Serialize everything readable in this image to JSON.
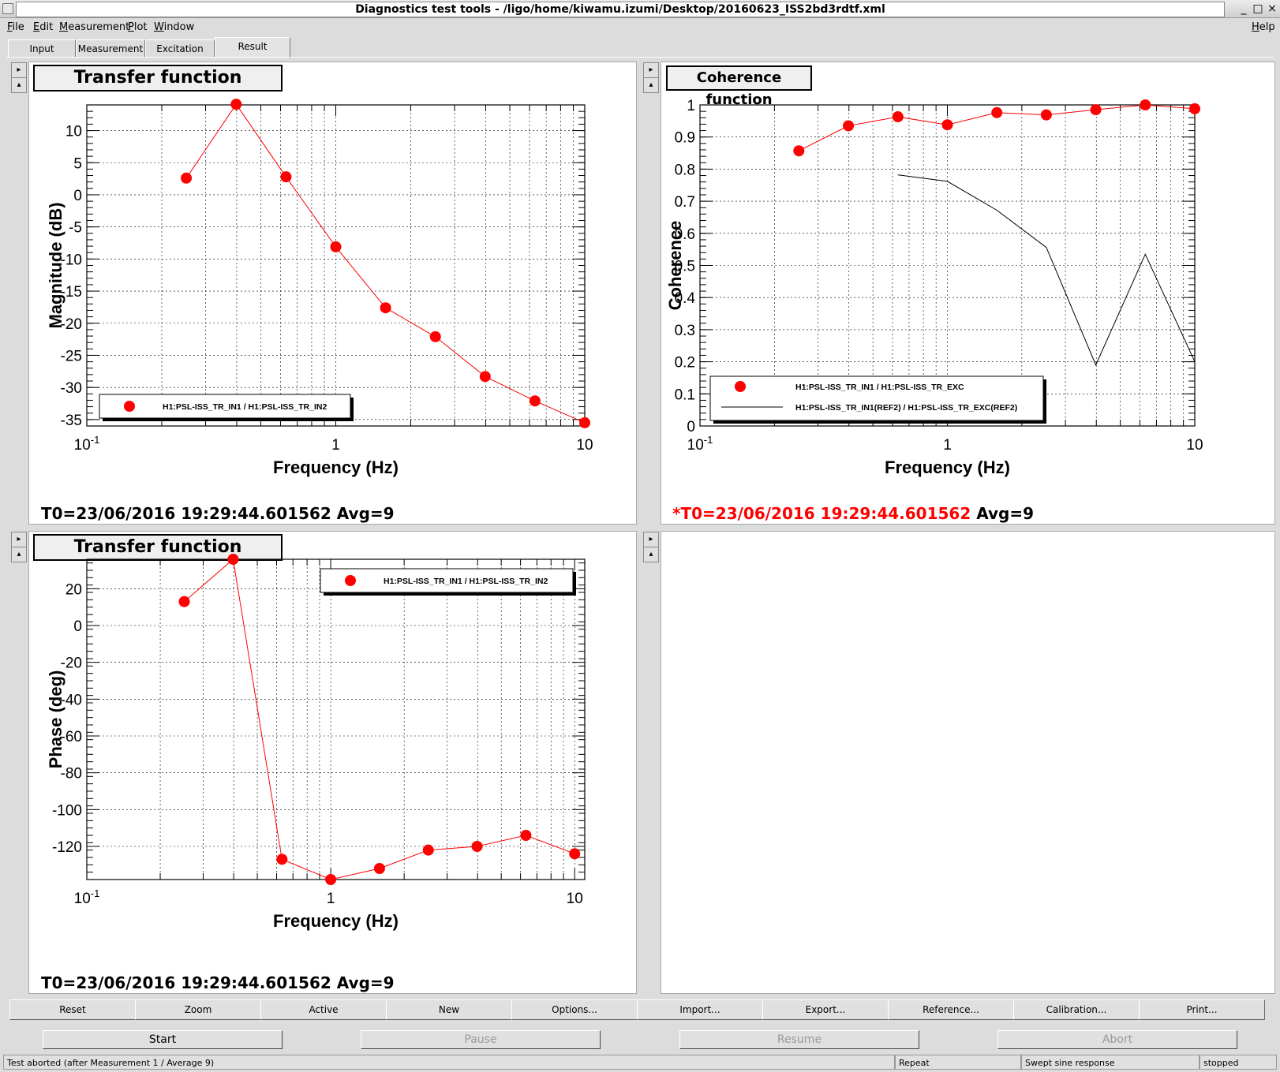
{
  "window": {
    "title": "Diagnostics test tools - /ligo/home/kiwamu.izumi/Desktop/20160623_ISS2bd3rdtf.xml",
    "minimize": "_",
    "maximize": "□",
    "close": "×"
  },
  "menu": {
    "file": "File",
    "edit": "Edit",
    "measurement": "Measurement",
    "plot": "Plot",
    "window": "Window",
    "help": "Help"
  },
  "tabs": [
    "Input",
    "Measurement",
    "Excitation",
    "Result"
  ],
  "active_tab": "Result",
  "side_buttons": {
    "expand": "▸",
    "collapse": "▴"
  },
  "panels": {
    "top_left": {
      "title": "Transfer function",
      "t0_line": "T0=23/06/2016 19:29:44.601562   Avg=9"
    },
    "top_right": {
      "title": "Coherence function",
      "t0_prefix": "*T0=23/06/2016 19:29:44.601562",
      "t0_suffix": " Avg=9"
    },
    "bottom_left": {
      "title": "Transfer function",
      "t0_line": "T0=23/06/2016 19:29:44.601562   Avg=9"
    }
  },
  "chart_data": [
    {
      "type": "line",
      "id": "magnitude",
      "xscale": "log",
      "xlim": [
        0.1,
        10
      ],
      "ylim": [
        -36,
        14
      ],
      "xlabel": "Frequency (Hz)",
      "ylabel": "Magnitude (dB)",
      "xticks": [
        0.1,
        1,
        10
      ],
      "xtick_labels": [
        "10",
        "1",
        "10"
      ],
      "yticks": [
        10,
        5,
        0,
        -5,
        -10,
        -15,
        -20,
        -25,
        -30,
        -35
      ],
      "ytick_labels": [
        "10",
        "5",
        "0",
        "-5",
        "-10",
        "-15",
        "-20",
        "-25",
        "-30",
        "-35"
      ],
      "grid": true,
      "legend": "bottom-left",
      "series": [
        {
          "name": "H1:PSL-ISS_TR_IN1 / H1:PSL-ISS_TR_IN2",
          "color": "#ff0000",
          "marker": "circle",
          "x": [
            0.251,
            0.398,
            0.631,
            1.0,
            1.585,
            2.512,
            3.981,
            6.31,
            10.0
          ],
          "y": [
            2.6,
            14.1,
            2.8,
            -8.1,
            -17.6,
            -22.1,
            -28.3,
            -32.1,
            -35.5
          ]
        }
      ]
    },
    {
      "type": "line",
      "id": "coherence",
      "xscale": "log",
      "xlim": [
        0.1,
        10
      ],
      "ylim": [
        0,
        1
      ],
      "xlabel": "Frequency (Hz)",
      "ylabel": "Coherence",
      "xticks": [
        0.1,
        1,
        10
      ],
      "xtick_labels": [
        "10",
        "1",
        "10"
      ],
      "yticks": [
        1,
        0.9,
        0.8,
        0.7,
        0.6,
        0.5,
        0.4,
        0.3,
        0.2,
        0.1,
        0
      ],
      "ytick_labels": [
        "1",
        "0.9",
        "0.8",
        "0.7",
        "0.6",
        "0.5",
        "0.4",
        "0.3",
        "0.2",
        "0.1",
        "0"
      ],
      "grid": true,
      "legend": "bottom-center",
      "series": [
        {
          "name": "H1:PSL-ISS_TR_IN1 / H1:PSL-ISS_TR_EXC",
          "color": "#ff0000",
          "marker": "circle",
          "x": [
            0.251,
            0.398,
            0.631,
            1.0,
            1.585,
            2.512,
            3.981,
            6.31,
            10.0
          ],
          "y": [
            0.857,
            0.935,
            0.963,
            0.938,
            0.976,
            0.969,
            0.985,
            1.0,
            0.988
          ]
        },
        {
          "name": "H1:PSL-ISS_TR_IN1(REF2) / H1:PSL-ISS_TR_EXC(REF2)",
          "color": "#000000",
          "marker": "none",
          "x": [
            0.631,
            1.0,
            1.585,
            2.512,
            3.981,
            6.31,
            10.0
          ],
          "y": [
            0.782,
            0.762,
            0.672,
            0.556,
            0.19,
            0.535,
            0.2
          ]
        }
      ]
    },
    {
      "type": "line",
      "id": "phase",
      "xscale": "log",
      "xlim": [
        0.1,
        11
      ],
      "ylim": [
        -138,
        36
      ],
      "xlabel": "Frequency (Hz)",
      "ylabel": "Phase (deg)",
      "xticks": [
        0.1,
        1,
        10
      ],
      "xtick_labels": [
        "10",
        "1",
        "10"
      ],
      "yticks": [
        20,
        0,
        -20,
        -40,
        -60,
        -80,
        -100,
        -120
      ],
      "ytick_labels": [
        "20",
        "0",
        "-20",
        "-40",
        "-60",
        "-80",
        "-100",
        "-120"
      ],
      "grid": true,
      "legend": "top-right",
      "series": [
        {
          "name": "H1:PSL-ISS_TR_IN1 / H1:PSL-ISS_TR_IN2",
          "color": "#ff0000",
          "marker": "circle",
          "x": [
            0.251,
            0.398,
            0.631,
            1.0,
            1.585,
            2.512,
            3.981,
            6.31,
            10.0
          ],
          "y": [
            13,
            36,
            -127,
            -138,
            -132,
            -122,
            -120,
            -114,
            -124
          ]
        }
      ]
    }
  ],
  "buttons_row1": [
    "Reset",
    "Zoom",
    "Active",
    "New",
    "Options...",
    "Import...",
    "Export...",
    "Reference...",
    "Calibration...",
    "Print..."
  ],
  "buttons_row2": [
    {
      "label": "Start",
      "enabled": true
    },
    {
      "label": "Pause",
      "enabled": false
    },
    {
      "label": "Resume",
      "enabled": false
    },
    {
      "label": "Abort",
      "enabled": false
    }
  ],
  "status": {
    "message": "Test aborted (after Measurement 1 / Average 9)",
    "repeat": "Repeat",
    "mode": "Swept sine response",
    "state": "stopped"
  }
}
